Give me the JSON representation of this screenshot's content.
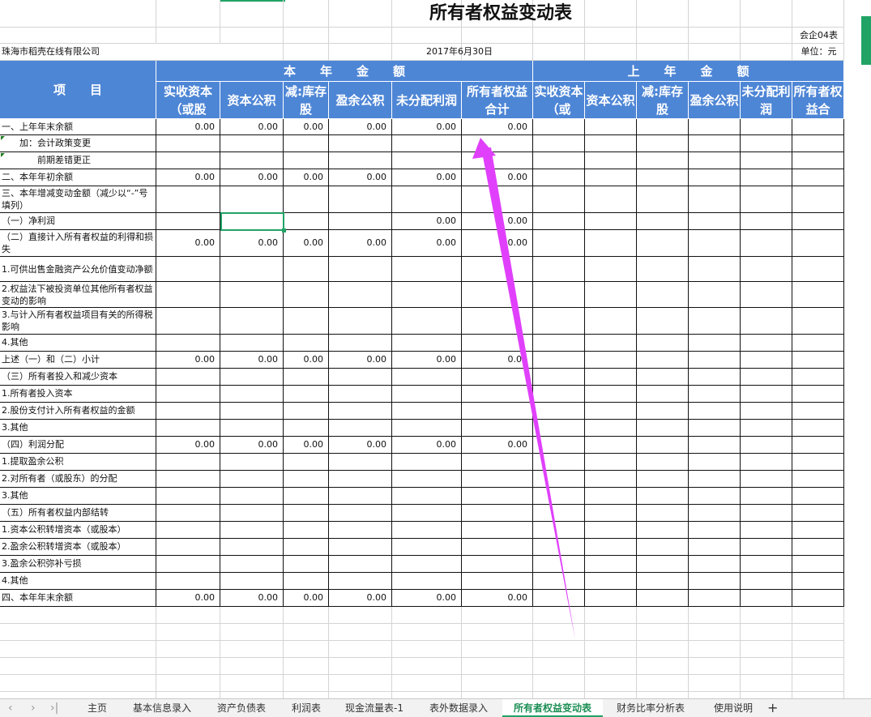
{
  "title": "所有者权益变动表",
  "form_code": "会企04表",
  "company": "珠海市稻壳在线有限公司",
  "date": "2017年6月30日",
  "unit": "单位：元",
  "header": {
    "group_current": "本　　年　　金　　额",
    "group_previous": "上　　年　　金　　额",
    "item_col": "项　　目",
    "current_cols": [
      "实收资本（或股",
      "资本公积",
      "减:库存股",
      "盈余公积",
      "未分配利润",
      "所有者权益合计"
    ],
    "previous_cols": [
      "实收资本（或",
      "资本公积",
      "减:库存股",
      "盈余公积",
      "未分配利润",
      "所有者权益合"
    ]
  },
  "rows": [
    {
      "label": "一、上年年末余额",
      "values": [
        "0.00",
        "0.00",
        "0.00",
        "0.00",
        "0.00",
        "0.00"
      ]
    },
    {
      "label": "　　加：会计政策变更",
      "values": []
    },
    {
      "label": "　　　　前期差错更正",
      "values": []
    },
    {
      "label": "二、本年年初余额",
      "values": [
        "0.00",
        "0.00",
        "0.00",
        "0.00",
        "0.00",
        "0.00"
      ]
    },
    {
      "label": "三、本年增减变动金额（减少以“-”号填列）",
      "values": []
    },
    {
      "label": "（一）净利润",
      "values": [
        "",
        "",
        "",
        "",
        "0.00",
        "0.00"
      ]
    },
    {
      "label": "（二）直接计入所有者权益的利得和损失",
      "values": [
        "0.00",
        "0.00",
        "0.00",
        "0.00",
        "0.00",
        "0.00"
      ]
    },
    {
      "label": "1.可供出售金融资产公允价值变动净额",
      "values": []
    },
    {
      "label": "2.权益法下被投资单位其他所有者权益变动的影响",
      "values": []
    },
    {
      "label": "3.与计入所有者权益项目有关的所得税影响",
      "values": []
    },
    {
      "label": "4.其他",
      "values": []
    },
    {
      "label": "上述（一）和（二）小计",
      "values": [
        "0.00",
        "0.00",
        "0.00",
        "0.00",
        "0.00",
        "0.00"
      ]
    },
    {
      "label": "（三）所有者投入和减少资本",
      "values": []
    },
    {
      "label": "1.所有者投入资本",
      "values": []
    },
    {
      "label": "2.股份支付计入所有者权益的金额",
      "values": []
    },
    {
      "label": "3.其他",
      "values": []
    },
    {
      "label": "（四）利润分配",
      "values": [
        "0.00",
        "0.00",
        "0.00",
        "0.00",
        "0.00",
        "0.00"
      ]
    },
    {
      "label": "1.提取盈余公积",
      "values": []
    },
    {
      "label": "2.对所有者（或股东）的分配",
      "values": []
    },
    {
      "label": "3.其他",
      "values": []
    },
    {
      "label": "（五）所有者权益内部结转",
      "values": []
    },
    {
      "label": "1.资本公积转增资本（或股本）",
      "values": []
    },
    {
      "label": "2.盈余公积转增资本（或股本）",
      "values": []
    },
    {
      "label": "3.盈余公积弥补亏损",
      "values": []
    },
    {
      "label": "4.其他",
      "values": []
    },
    {
      "label": "四、本年年末余额",
      "values": [
        "0.00",
        "0.00",
        "0.00",
        "0.00",
        "0.00",
        "0.00"
      ]
    }
  ],
  "tabs": [
    "主页",
    "基本信息录入",
    "资产负债表",
    "利润表",
    "现金流量表-1",
    "表外数据录入",
    "所有者权益变动表",
    "财务比率分析表",
    "使用说明"
  ],
  "active_tab": "所有者权益变动表",
  "nav": {
    "prev_all": "〈",
    "prev": "〉",
    "last": "〉|",
    "add": "+"
  },
  "colors": {
    "header_blue": "#4e86d6",
    "accent_green": "#21a366",
    "arrow": "#e040fb"
  }
}
